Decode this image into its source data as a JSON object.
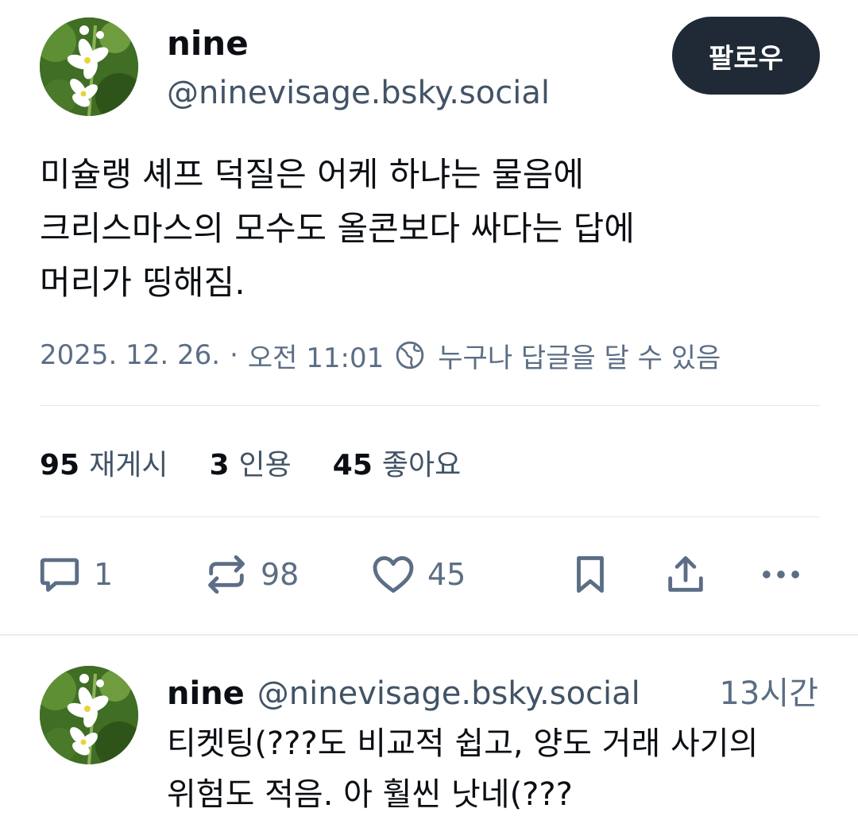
{
  "post": {
    "author_name": "nine",
    "author_handle": "@ninevisage.bsky.social",
    "follow_label": "팔로우",
    "text_lines": [
      "미슐랭 셰프 덕질은 어케 하냐는 물음에",
      "크리스마스의 모수도 올콘보다 싸다는 답에",
      "머리가 띵해짐."
    ],
    "date": "2025. 12. 26.",
    "separator": "·",
    "time": "오전 11:01",
    "reply_permission": "누구나 답글을 달 수 있음",
    "stats": {
      "reposts": {
        "count": "95",
        "label": "재게시"
      },
      "quotes": {
        "count": "3",
        "label": "인용"
      },
      "likes": {
        "count": "45",
        "label": "좋아요"
      }
    },
    "actions": {
      "reply_count": "1",
      "repost_count": "98",
      "like_count": "45"
    }
  },
  "reply": {
    "author_name": "nine",
    "author_handle": "@ninevisage.bsky.social",
    "time": "13시간",
    "text_lines": [
      "티켓팅(???도 비교적 쉽고, 양도 거래 사기의",
      "위험도 적음. 아 훨씬 낫네(???"
    ]
  },
  "icons": {
    "reply": "speech-bubble-icon",
    "repost": "repost-arrows-icon",
    "like": "heart-icon",
    "bookmark": "bookmark-icon",
    "share": "share-upload-icon",
    "more": "ellipsis-icon",
    "reply_permission": "globe-icon"
  },
  "colors": {
    "follow_button_bg": "#202a36",
    "secondary_text": "#5b6e85",
    "handle_text": "#425366",
    "divider": "#e4e8ec"
  }
}
